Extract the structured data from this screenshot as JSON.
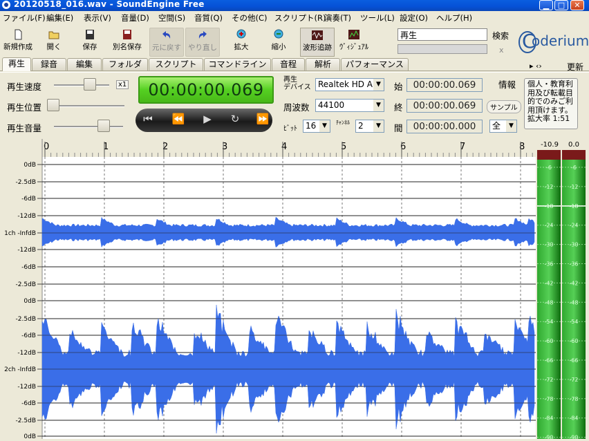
{
  "window": {
    "title": "20120518_016.wav - SoundEngine Free"
  },
  "menu": [
    "ファイル(F)",
    "編集(E)",
    "表示(V)",
    "音量(D)",
    "空間(S)",
    "音質(Q)",
    "その他(C)",
    "スクリプト(R)",
    "演奏(T)",
    "ツール(L)",
    "設定(O)",
    "ヘルプ(H)"
  ],
  "toolbar": {
    "new": "新規作成",
    "open": "開く",
    "save": "保存",
    "saveas": "別名保存",
    "undo": "元に戻す",
    "redo": "やり直し",
    "zoom_in": "拡大",
    "zoom_out": "縮小",
    "wave_follow": "波形追跡",
    "visual": "ｳﾞｨｼﾞｭｱﾙ",
    "search_value": "再生",
    "search_label": "検索",
    "close_x": "x",
    "logo": "oderium",
    "logo_c": "C"
  },
  "tabs": [
    "再生",
    "録音",
    "編集",
    "フォルダ",
    "スクリプト",
    "コマンドライン",
    "音程",
    "解析",
    "パフォーマンス"
  ],
  "tab_right": {
    "arrows": "▸ ‹›",
    "update": "更新"
  },
  "playback": {
    "speed_label": "再生速度",
    "speed_mult": "x1",
    "position_label": "再生位置",
    "volume_label": "再生音量",
    "speed_level": 0.65,
    "volume_level": 0.72,
    "timer": "00:00:00.069"
  },
  "device": {
    "label": "再生\nデバイス",
    "value": "Realtek HD A",
    "freq_label": "周波数",
    "freq_value": "44100",
    "bit_label": "ﾋﾞｯﾄ",
    "bit_value": "16",
    "ch_label": "ﾁｬﾝﾈﾙ",
    "ch_value": "2"
  },
  "range": {
    "start_label": "始",
    "start": "00:00:00.069",
    "end_label": "終",
    "end": "00:00:00.069",
    "len_label": "間",
    "len": "00:00:00.000",
    "sample_label": "サンプル",
    "all_value": "全"
  },
  "info": {
    "label": "情報",
    "text": "個人・教育利用及び転載目的でのみご利用頂けます。",
    "extra": "拡大率 1:51"
  },
  "timeline": {
    "ticks": [
      "0",
      "1",
      "2",
      "3",
      "4",
      "5",
      "6",
      "7",
      "8"
    ]
  },
  "channels": [
    {
      "labels": [
        "0dB",
        "-2.5dB",
        "-6dB",
        "-12dB",
        "1ch -InfdB",
        "-12dB",
        "-6dB",
        "-2.5dB",
        "0dB"
      ]
    },
    {
      "labels": [
        "-2.5dB",
        "-6dB",
        "-12dB",
        "2ch -InfdB",
        "-12dB",
        "-6dB",
        "-2.5dB",
        "0dB"
      ]
    }
  ],
  "meter": {
    "left_peak": "-10.9",
    "right_peak": "0.0",
    "scale": [
      "-6",
      "-12",
      "-18",
      "-24",
      "-30",
      "-36",
      "-42",
      "-48",
      "-54",
      "-60",
      "-66",
      "-72",
      "-78",
      "-84",
      "-90"
    ],
    "colors": {
      "high": "#2fa82f",
      "low": "#0e6c0e",
      "clip": "#7a1a1a"
    }
  },
  "colors": {
    "wave": "#3a6ee8",
    "title": "#0a5ee0"
  }
}
